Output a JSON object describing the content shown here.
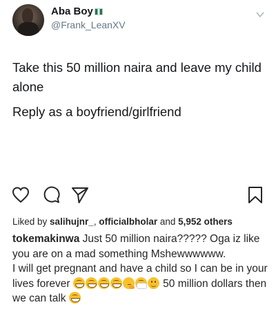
{
  "tweet": {
    "display_name": "Aba Boy",
    "handle": "@Frank_LeanXV",
    "flag": "Nigeria flag",
    "text_line1": "Take this 50 million naira and leave my child alone",
    "text_line2": "Reply as a boyfriend/girlfriend"
  },
  "post": {
    "icons": [
      "heart-icon",
      "comment-icon",
      "share-icon",
      "bookmark-icon"
    ],
    "likes": {
      "prefix": "Liked by ",
      "user1": "salihujnr_",
      "sep": ", ",
      "user2": "officialbholar",
      "and": " and ",
      "count": "5,952 others"
    },
    "caption": {
      "username": "tokemakinwa",
      "text_a": " Just 50 million naira????? Oga iz like you are on a mad something Mshewwwwww.",
      "text_b": "I will get pregnant and have a child so I can be in your lives forever ",
      "text_c": " 50 million dollars then we can talk ",
      "emojis": [
        "grin-emoji",
        "grin-emoji",
        "grin-emoji",
        "grin-emoji",
        "thinking-emoji",
        "mask-emoji",
        "smile-emoji"
      ],
      "end_emoji": "grin-emoji"
    }
  },
  "colors": {
    "text": "#262626",
    "handle": "#657786",
    "emoji": "#f7c22e"
  }
}
